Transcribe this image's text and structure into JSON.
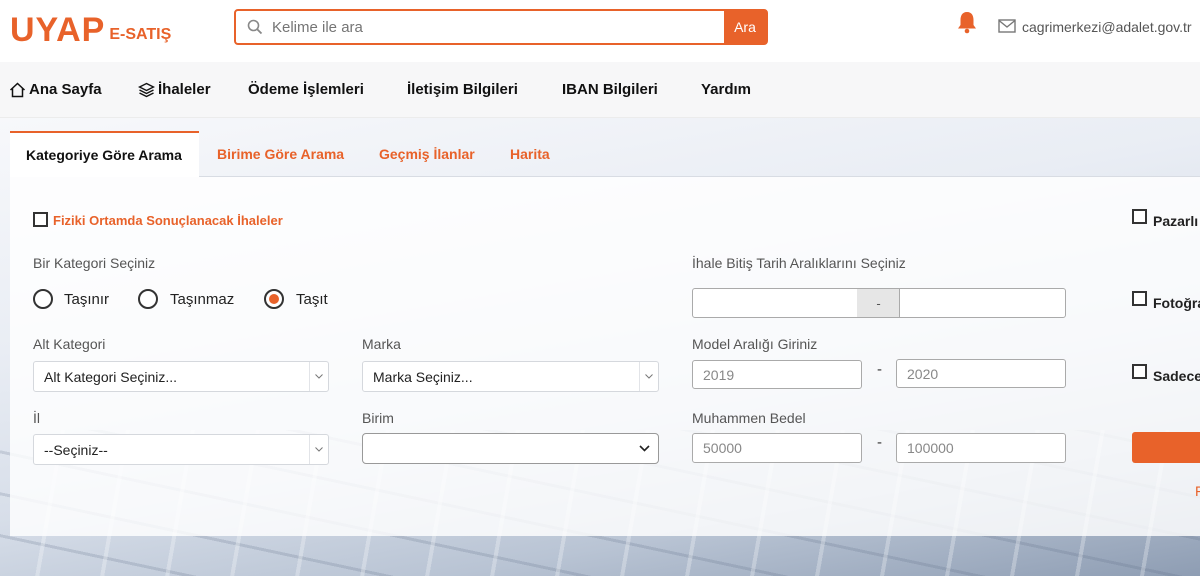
{
  "header": {
    "logo_main": "UYAP",
    "logo_sub": "E-SATIŞ",
    "search_placeholder": "Kelime ile ara",
    "search_button": "Ara",
    "email": "cagrimerkezi@adalet.gov.tr"
  },
  "nav": {
    "items": [
      {
        "label": "Ana Sayfa",
        "icon": "home-icon"
      },
      {
        "label": "İhaleler",
        "icon": "layers-icon"
      },
      {
        "label": "Ödeme İşlemleri"
      },
      {
        "label": "İletişim Bilgileri"
      },
      {
        "label": "IBAN Bilgileri"
      },
      {
        "label": "Yardım"
      }
    ]
  },
  "tabs": [
    {
      "label": "Kategoriye Göre Arama",
      "active": true
    },
    {
      "label": "Birime Göre Arama"
    },
    {
      "label": "Geçmiş İlanlar"
    },
    {
      "label": "Harita"
    }
  ],
  "form": {
    "physical_checkbox_label": "Fiziki Ortamda Sonuçlanacak İhaleler",
    "category_label": "Bir Kategori Seçiniz",
    "radios": [
      {
        "label": "Taşınır",
        "checked": false
      },
      {
        "label": "Taşınmaz",
        "checked": false
      },
      {
        "label": "Taşıt",
        "checked": true
      }
    ],
    "subcategory_label": "Alt Kategori",
    "subcategory_value": "Alt Kategori Seçiniz...",
    "brand_label": "Marka",
    "brand_value": "Marka Seçiniz...",
    "city_label": "İl",
    "city_value": "--Seçiniz--",
    "unit_label": "Birim",
    "unit_value": "",
    "date_range_label": "İhale Bitiş Tarih Aralıklarını Seçiniz",
    "date_separator": "-",
    "model_range_label": "Model Aralığı Giriniz",
    "model_from_placeholder": "2019",
    "model_to_placeholder": "2020",
    "range_dash": "-",
    "price_label": "Muhammen Bedel",
    "price_from_placeholder": "50000",
    "price_to_placeholder": "100000"
  },
  "right_column": {
    "items": [
      "Pazarlı",
      "Fotoğra",
      "Sadece"
    ],
    "link_text": "F"
  },
  "colors": {
    "accent": "#e8622a"
  }
}
